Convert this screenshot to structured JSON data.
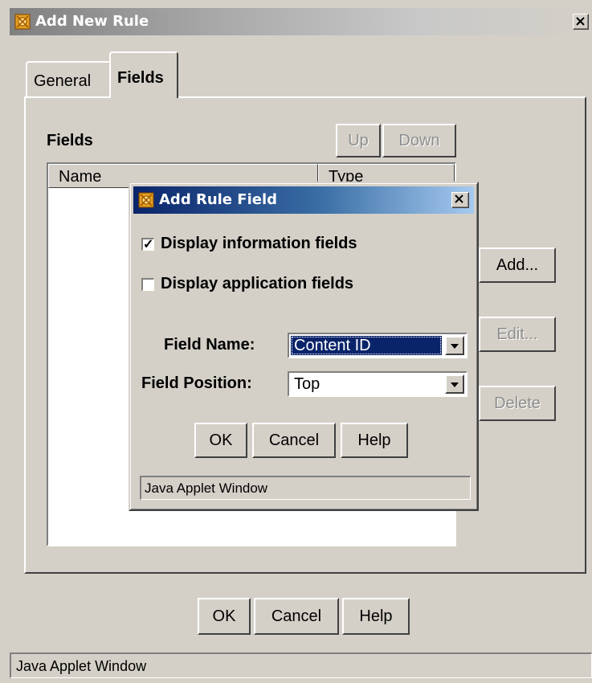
{
  "window": {
    "title": "Add New Rule",
    "status_text": "Java Applet Window"
  },
  "tabs": [
    {
      "label": "General",
      "active": false
    },
    {
      "label": "Fields",
      "active": true
    }
  ],
  "fields_panel": {
    "section_label": "Fields",
    "up_label": "Up",
    "down_label": "Down",
    "columns": [
      "Name",
      "Type"
    ],
    "add_label": "Add...",
    "edit_label": "Edit...",
    "delete_label": "Delete"
  },
  "footer": {
    "ok_label": "OK",
    "cancel_label": "Cancel",
    "help_label": "Help"
  },
  "dialog": {
    "title": "Add Rule Field",
    "display_info_label": "Display information fields",
    "display_info_checked": true,
    "display_app_label": "Display application fields",
    "display_app_checked": false,
    "field_name_label": "Field Name:",
    "field_name_value": "Content ID",
    "field_position_label": "Field Position:",
    "field_position_value": "Top",
    "ok_label": "OK",
    "cancel_label": "Cancel",
    "help_label": "Help",
    "status_text": "Java Applet Window"
  },
  "icons": {
    "app": "java-applet-icon",
    "close": "close-icon"
  }
}
